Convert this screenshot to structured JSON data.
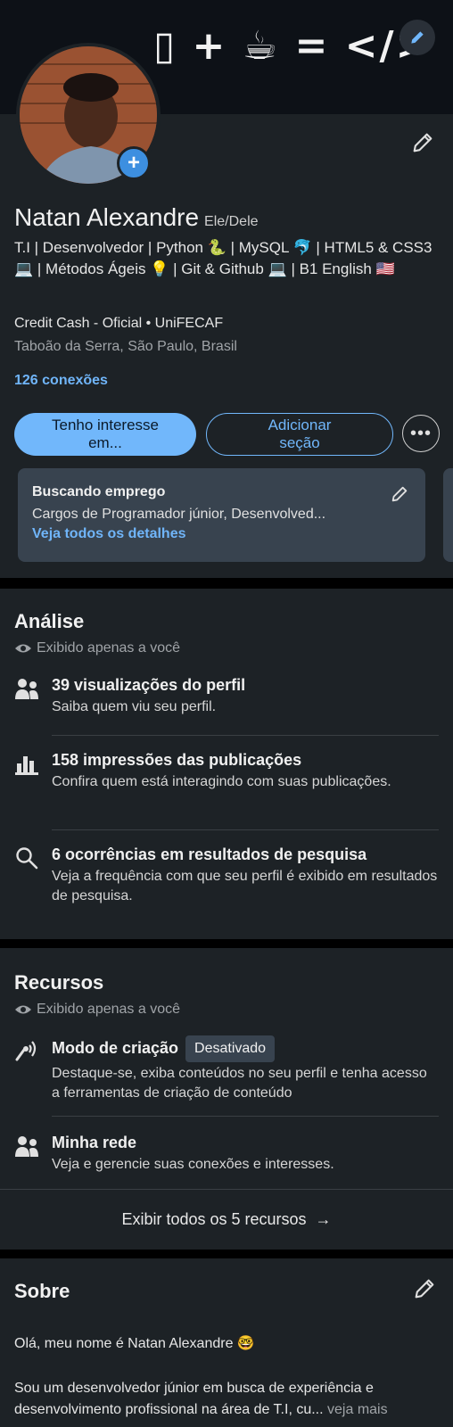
{
  "banner": {
    "art_text": "▯ + ☕ = </>",
    "edit_icon": "pencil-icon"
  },
  "profile": {
    "name": "Natan Alexandre",
    "pronouns": "Ele/Dele",
    "headline": "T.I | Desenvolvedor | Python 🐍 | MySQL 🐬 | HTML5 & CSS3 💻 | Métodos Ágeis 💡 | Git & Github 💻 | B1 English 🇺🇸",
    "organization": "Credit Cash - Oficial • UniFECAF",
    "location": "Taboão da Serra, São Paulo, Brasil",
    "connections": "126 conexões",
    "add_photo_symbol": "+",
    "buttons": {
      "interest": "Tenho interesse em...",
      "add_section": "Adicionar seção",
      "more": "•••"
    },
    "open_to_work": {
      "title": "Buscando emprego",
      "description": "Cargos de Programador júnior, Desenvolved...",
      "link": "Veja todos os detalhes"
    }
  },
  "analytics": {
    "title": "Análise",
    "private_note": "Exibido apenas a você",
    "items": [
      {
        "icon": "people-icon",
        "title": "39 visualizações do perfil",
        "desc": "Saiba quem viu seu perfil."
      },
      {
        "icon": "bar-chart-icon",
        "title": "158 impressões das publicações",
        "desc": "Confira quem está interagindo com suas publicações."
      },
      {
        "icon": "search-icon",
        "title": "6 ocorrências em resultados de pesquisa",
        "desc": "Veja a frequência com que seu perfil é exibido em resultados de pesquisa."
      }
    ]
  },
  "resources": {
    "title": "Recursos",
    "private_note": "Exibido apenas a você",
    "items": [
      {
        "icon": "broadcast-icon",
        "title": "Modo de criação",
        "badge": "Desativado",
        "desc": "Destaque-se, exiba conteúdos no seu perfil e tenha acesso a ferramentas de criação de conteúdo"
      },
      {
        "icon": "people-icon",
        "title": "Minha rede",
        "desc": "Veja e gerencie suas conexões e interesses."
      }
    ],
    "show_all": "Exibir todos os 5 recursos",
    "show_all_arrow": "→"
  },
  "about": {
    "title": "Sobre",
    "greeting": "Olá, meu nome é Natan Alexandre 🤓",
    "body": "Sou um desenvolvedor júnior em busca de experiência e desenvolvimento profissional na área de T.I, cu...",
    "see_more": "veja mais"
  },
  "colors": {
    "background": "#000000",
    "card": "#1d2226",
    "accent": "#71b7fb",
    "muted": "#a0a4a8"
  }
}
